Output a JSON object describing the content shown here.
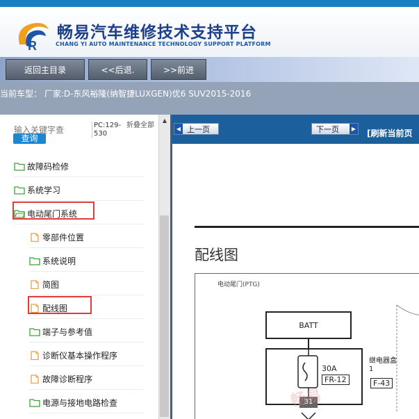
{
  "header": {
    "title": "畅易汽车维修技术支持平台",
    "subtitle": "CHANG YI AUTO MAINTENANCE TECHNOLOGY SUPPORT PLATFORM"
  },
  "nav": {
    "home": "返回主目录",
    "back": "<<后退.",
    "forward": ">>前进"
  },
  "model": {
    "text": "当前车型： 厂家:D-东风裕隆(纳智捷LUXGEN)优6 SUV2015-2016"
  },
  "sidebar": {
    "search_placeholder": "输入关键字查",
    "search_button": "查询",
    "pc": "PC:129-530",
    "collapse": "折叠全部",
    "items": [
      {
        "label": "故障码检修",
        "icon": "folder-icon",
        "level": 0
      },
      {
        "label": "系统学习",
        "icon": "folder-icon",
        "level": 0
      },
      {
        "label": "电动尾门系统",
        "icon": "folder-open-icon",
        "level": 0,
        "highlighted": true
      },
      {
        "label": "零部件位置",
        "icon": "page-icon",
        "level": 1
      },
      {
        "label": "系统说明",
        "icon": "folder-icon",
        "level": 1
      },
      {
        "label": "简图",
        "icon": "page-icon",
        "level": 1
      },
      {
        "label": "配线图",
        "icon": "page-icon",
        "level": 1,
        "highlighted": true
      },
      {
        "label": "端子与参考值",
        "icon": "folder-icon",
        "level": 1
      },
      {
        "label": "诊断仪基本操作程序",
        "icon": "page-icon",
        "level": 1
      },
      {
        "label": "故障诊断程序",
        "icon": "page-icon",
        "level": 1
      },
      {
        "label": "电源与接地电路检查",
        "icon": "folder-icon",
        "level": 1
      }
    ]
  },
  "doc": {
    "prev": "上一页",
    "next": "下一页",
    "refresh": "[刷新当前页",
    "title": "配线图",
    "diagram": {
      "label": "电动尾门(PTG)",
      "batt": "BATT",
      "fuse": "30A",
      "fuse_code": "FR-12",
      "relay_box": "继电器盒 1",
      "relay_code": "F-43",
      "pin": "31"
    }
  },
  "watermark": "畅易",
  "colors": {
    "topbar": "#1b7fc4",
    "doc_bar": "#1b5f9c",
    "search_button": "#1e86d0",
    "highlight": "#e03a3a",
    "folder": "#3aa23a",
    "page": "#e8a040"
  }
}
